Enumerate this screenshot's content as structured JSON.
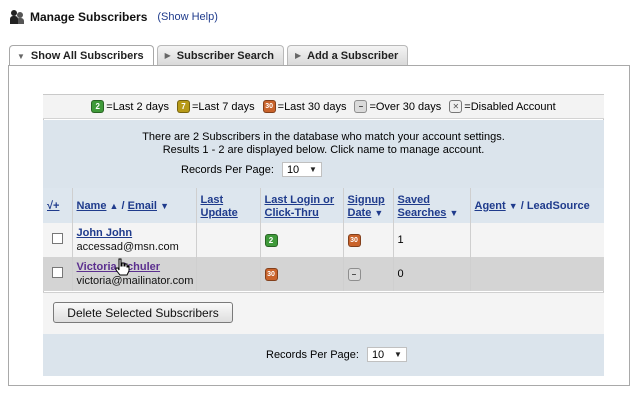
{
  "header": {
    "title": "Manage Subscribers",
    "help_link": "(Show Help)"
  },
  "tabs": [
    {
      "label": "Show All Subscribers",
      "active": true
    },
    {
      "label": "Subscriber Search",
      "active": false
    },
    {
      "label": "Add a Subscriber",
      "active": false
    }
  ],
  "legend": [
    {
      "icon": "green-badge-icon",
      "glyph": "2",
      "label": "=Last 2 days"
    },
    {
      "icon": "yellow-badge-icon",
      "glyph": "7",
      "label": "=Last 7 days"
    },
    {
      "icon": "orange-badge-icon",
      "glyph": "30",
      "label": "=Last 30 days"
    },
    {
      "icon": "gray-badge-icon",
      "glyph": "–",
      "label": "=Over 30 days"
    },
    {
      "icon": "disabled-icon",
      "glyph": "✕",
      "label": "=Disabled Account"
    }
  ],
  "info": {
    "line1": "There are 2 Subscribers in the database who match your account settings.",
    "line2": "Results 1 - 2 are displayed below. Click name to manage account.",
    "records_per_page_label": "Records Per Page:",
    "records_per_page_value": "10"
  },
  "table": {
    "headers": {
      "check": "√+",
      "name": "Name",
      "email": "Email",
      "last_update_1": "Last",
      "last_update_2": "Update",
      "last_login_1": "Last Login or",
      "last_login_2": "Click-Thru",
      "signup_1": "Signup",
      "signup_2": "Date",
      "saved_1": "Saved",
      "saved_2": "Searches",
      "agent": "Agent",
      "leadsource": "/ LeadSource"
    },
    "rows": [
      {
        "name": "John John",
        "email": "accessad@msn.com",
        "last_update": "",
        "last_login_icon": "2",
        "signup_icon": "30",
        "saved": "1",
        "agent": ""
      },
      {
        "name": "Victoria Schuler",
        "email": "victoria@mailinator.com",
        "last_update": "",
        "last_login_icon": "30",
        "signup_icon": "–",
        "saved": "0",
        "agent": ""
      }
    ]
  },
  "actions": {
    "delete_label": "Delete Selected Subscribers"
  },
  "footer": {
    "records_per_page_label": "Records Per Page:",
    "records_per_page_value": "10"
  },
  "colors": {
    "link": "#1f3b8c",
    "info_bg": "#dbe4ec",
    "row_alt": "#d4d4d4"
  }
}
